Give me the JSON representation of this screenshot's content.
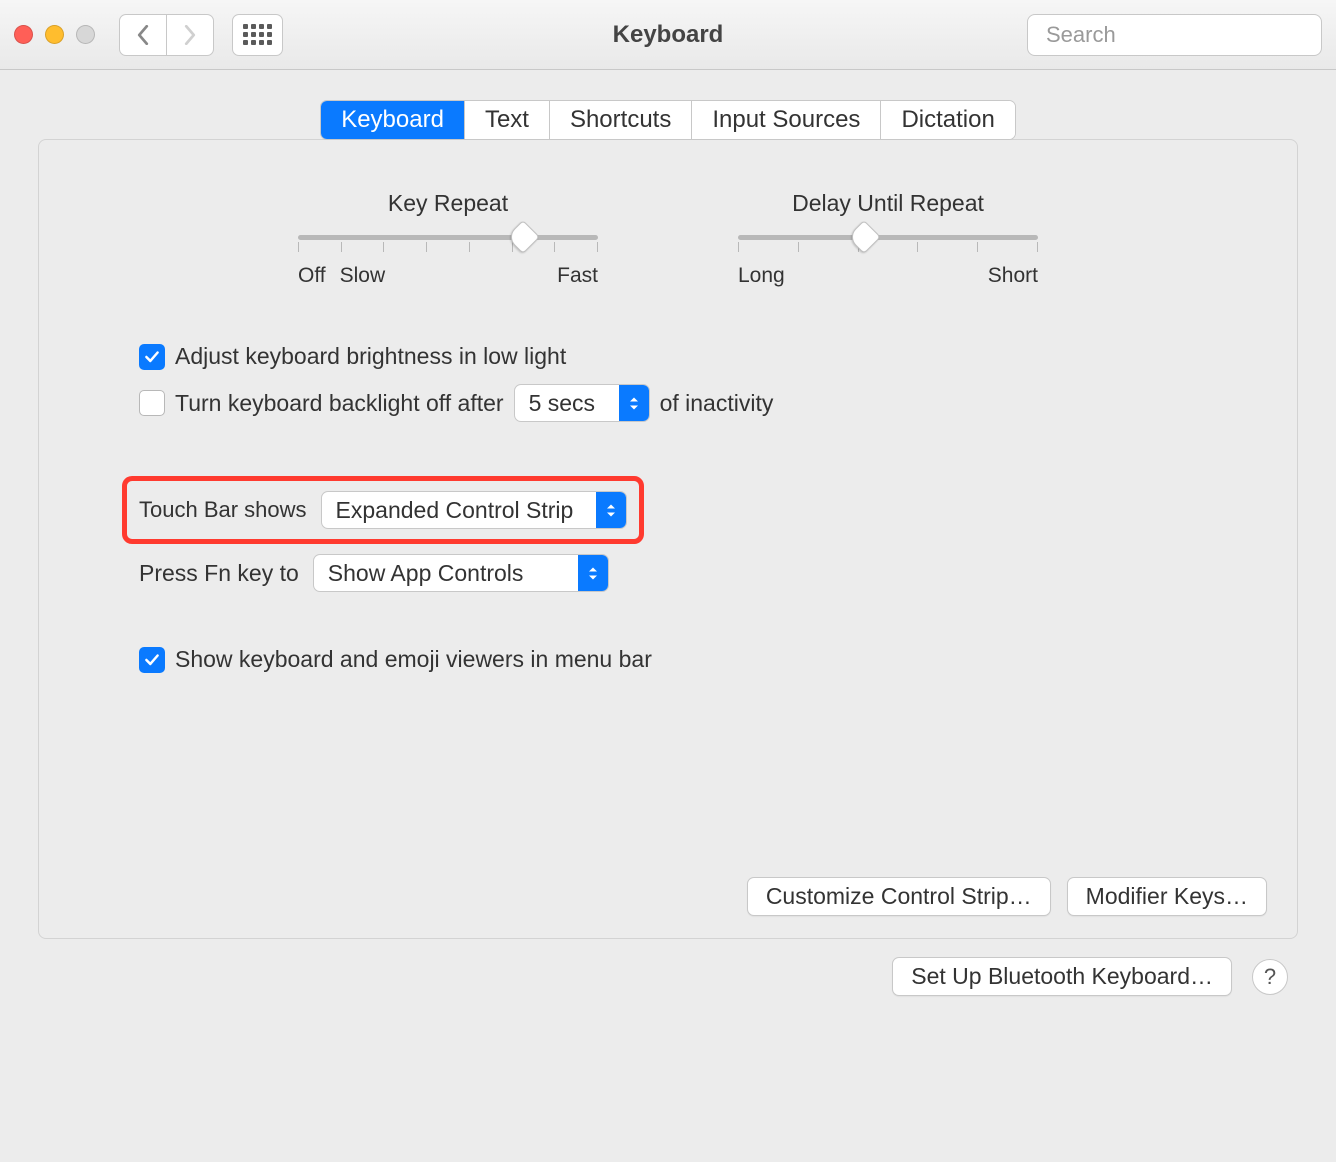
{
  "window": {
    "title": "Keyboard"
  },
  "search": {
    "placeholder": "Search"
  },
  "tabs": [
    {
      "label": "Keyboard",
      "active": true
    },
    {
      "label": "Text",
      "active": false
    },
    {
      "label": "Shortcuts",
      "active": false
    },
    {
      "label": "Input Sources",
      "active": false
    },
    {
      "label": "Dictation",
      "active": false
    }
  ],
  "sliders": {
    "keyRepeat": {
      "title": "Key Repeat",
      "leftLabel1": "Off",
      "leftLabel2": "Slow",
      "rightLabel": "Fast",
      "position": 75
    },
    "delayRepeat": {
      "title": "Delay Until Repeat",
      "leftLabel": "Long",
      "rightLabel": "Short",
      "position": 42
    }
  },
  "options": {
    "adjustBrightness": {
      "label": "Adjust keyboard brightness in low light",
      "checked": true
    },
    "backlightOff": {
      "label1": "Turn keyboard backlight off after",
      "value": "5 secs",
      "label2": "of inactivity",
      "checked": false
    },
    "touchBar": {
      "label": "Touch Bar shows",
      "value": "Expanded Control Strip"
    },
    "fnKey": {
      "label": "Press Fn key to",
      "value": "Show App Controls"
    },
    "showViewers": {
      "label": "Show keyboard and emoji viewers in menu bar",
      "checked": true
    }
  },
  "buttons": {
    "customizeStrip": "Customize Control Strip…",
    "modifierKeys": "Modifier Keys…",
    "bluetooth": "Set Up Bluetooth Keyboard…",
    "help": "?"
  }
}
